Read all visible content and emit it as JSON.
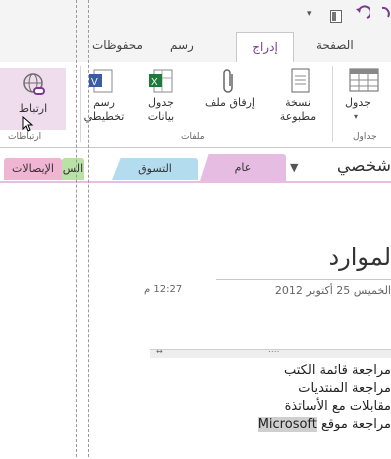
{
  "titlebar": {
    "undo_icon": "undo-icon",
    "view_icon": "page-view-icon",
    "dropdown_icon": "chevron-down-icon"
  },
  "ribbon_tabs": {
    "page": "الصفحة",
    "insert": "إدراج",
    "draw": "رسم",
    "history": "محفوظات"
  },
  "ribbon": {
    "table_label": "جدول",
    "printout_label": "نسخة مطبوعة",
    "attach_label": "إرفاق ملف",
    "spreadsheet_label": "جدول بيانات",
    "diagram_label": "رسم تخطيطي",
    "link_label": "ارتباط",
    "groups": {
      "tables": "جداول",
      "files": "ملفات",
      "links": "ارتباطات"
    }
  },
  "notebook": {
    "name": "شخصي",
    "dropdown_icon": "chevron-down-icon"
  },
  "section_tabs": [
    "عام",
    "التسوق",
    "الس",
    "الإيصالات"
  ],
  "page": {
    "title": "لموارد",
    "date": "الخميس 25 أكتوبر 2012",
    "time": "12:27 م",
    "lines": [
      "مراجعة قائمة الكتب",
      "مراجعة المنتديات",
      "مقابلات مع الأساتذة",
      "مراجعة موقع"
    ],
    "highlight_word": "Microsoft"
  },
  "colors": {
    "accent": "#7a3b8e",
    "section_general": "#e6bce2",
    "section_shopping": "#b4dcef",
    "section_green": "#b9e1a8",
    "section_receipts": "#f1b5d4"
  }
}
